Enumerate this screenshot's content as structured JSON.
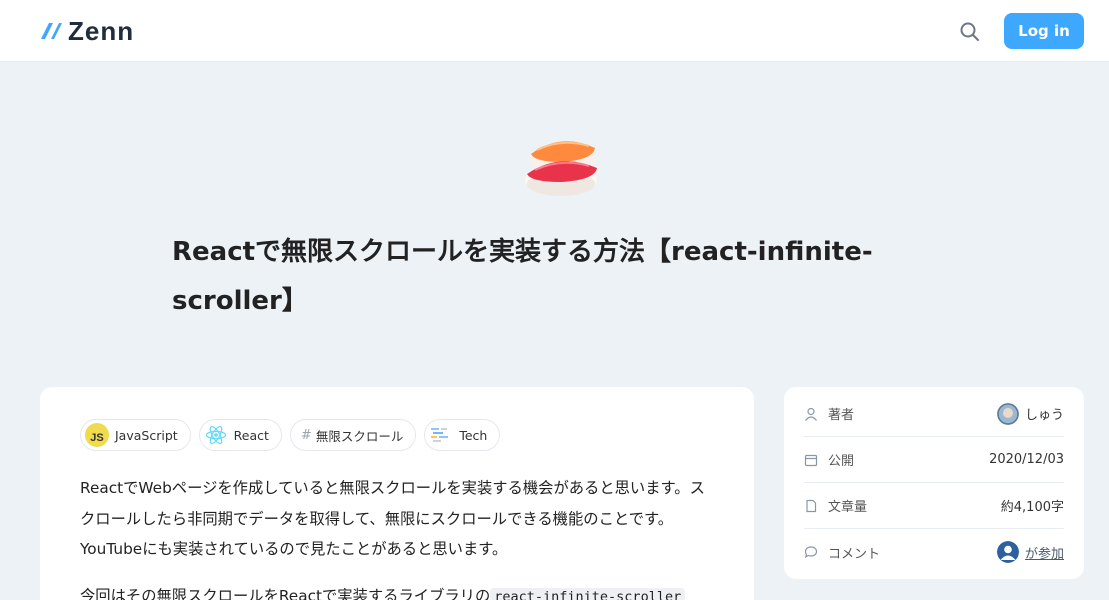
{
  "header": {
    "logo_text": "Zenn",
    "login_label": "Log in"
  },
  "article": {
    "title": "Reactで無限スクロールを実装する方法【react-infinite-scroller】",
    "topics": [
      {
        "label": "JavaScript",
        "icon": "javascript-icon"
      },
      {
        "label": "React",
        "icon": "react-icon"
      },
      {
        "label": "無限スクロール",
        "icon": "hash-icon"
      },
      {
        "label": "Tech",
        "icon": "tech-icon"
      }
    ],
    "paragraph1": "ReactでWebページを作成していると無限スクロールを実装する機会があると思います。スクロールしたら非同期でデータを取得して、無限にスクロールできる機能のことです。YouTubeにも実装されているので見たことがあると思います。",
    "paragraph2_prefix": "今回はその無限スクロールをReactで実装するライブラリの",
    "paragraph2_code": "react-infinite-scroller"
  },
  "sidebar": {
    "author_label": "著者",
    "author_name": "しゅう",
    "published_label": "公開",
    "published_date": "2020/12/03",
    "length_label": "文章量",
    "length_value": "約4,100字",
    "comment_label": "コメント",
    "comment_join": "が参加"
  },
  "colors": {
    "accent": "#3ea8ff",
    "background": "#edf2f7",
    "js_badge": "#f0db4f",
    "react": "#61dafb"
  }
}
